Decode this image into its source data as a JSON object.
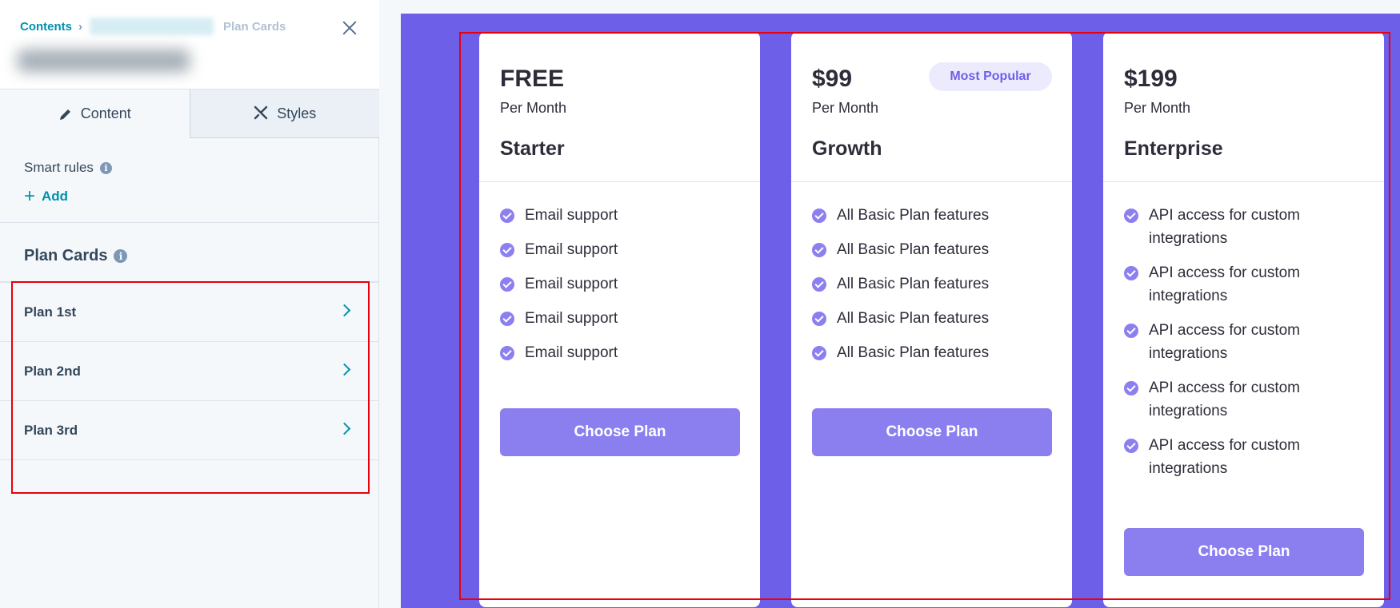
{
  "panel": {
    "breadcrumb": {
      "root": "Contents",
      "current": "Plan Cards"
    },
    "tabs": {
      "content": "Content",
      "styles": "Styles"
    },
    "smart_rules": {
      "label": "Smart rules",
      "add_label": "Add"
    },
    "plan_cards_title": "Plan Cards",
    "plan_items": [
      {
        "label": "Plan 1st"
      },
      {
        "label": "Plan 2nd"
      },
      {
        "label": "Plan 3rd"
      }
    ]
  },
  "preview": {
    "accent_color": "#6e5fe8",
    "plans": [
      {
        "price": "FREE",
        "period": "Per Month",
        "name": "Starter",
        "badge": "",
        "features": [
          "Email support",
          "Email support",
          "Email support",
          "Email support",
          "Email support"
        ],
        "button": "Choose Plan"
      },
      {
        "price": "$99",
        "period": "Per Month",
        "name": "Growth",
        "badge": "Most Popular",
        "features": [
          "All Basic Plan features",
          "All Basic Plan features",
          "All Basic Plan features",
          "All Basic Plan features",
          "All Basic Plan features"
        ],
        "button": "Choose Plan"
      },
      {
        "price": "$199",
        "period": "Per Month",
        "name": "Enterprise",
        "badge": "",
        "features": [
          "API access for custom integrations",
          "API access for custom integrations",
          "API access for custom integrations",
          "API access for custom integrations",
          "API access for custom integrations"
        ],
        "button": "Choose Plan"
      }
    ]
  }
}
